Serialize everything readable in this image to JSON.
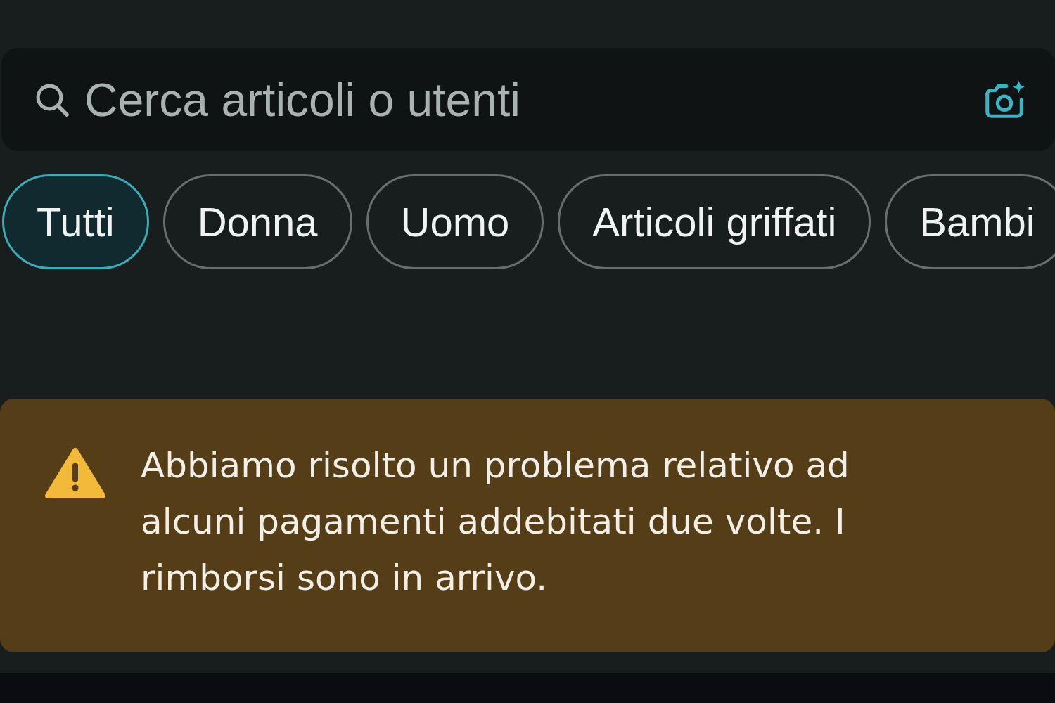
{
  "search": {
    "placeholder": "Cerca articoli o utenti"
  },
  "categories": [
    {
      "label": "Tutti",
      "selected": true
    },
    {
      "label": "Donna",
      "selected": false
    },
    {
      "label": "Uomo",
      "selected": false
    },
    {
      "label": "Articoli griffati",
      "selected": false
    },
    {
      "label": "Bambi",
      "selected": false
    }
  ],
  "notice": {
    "kind": "warning",
    "text": "Abbiamo risolto un problema relativo ad alcuni pagamenti addebitati due volte. I rimborsi sono in arrivo."
  }
}
